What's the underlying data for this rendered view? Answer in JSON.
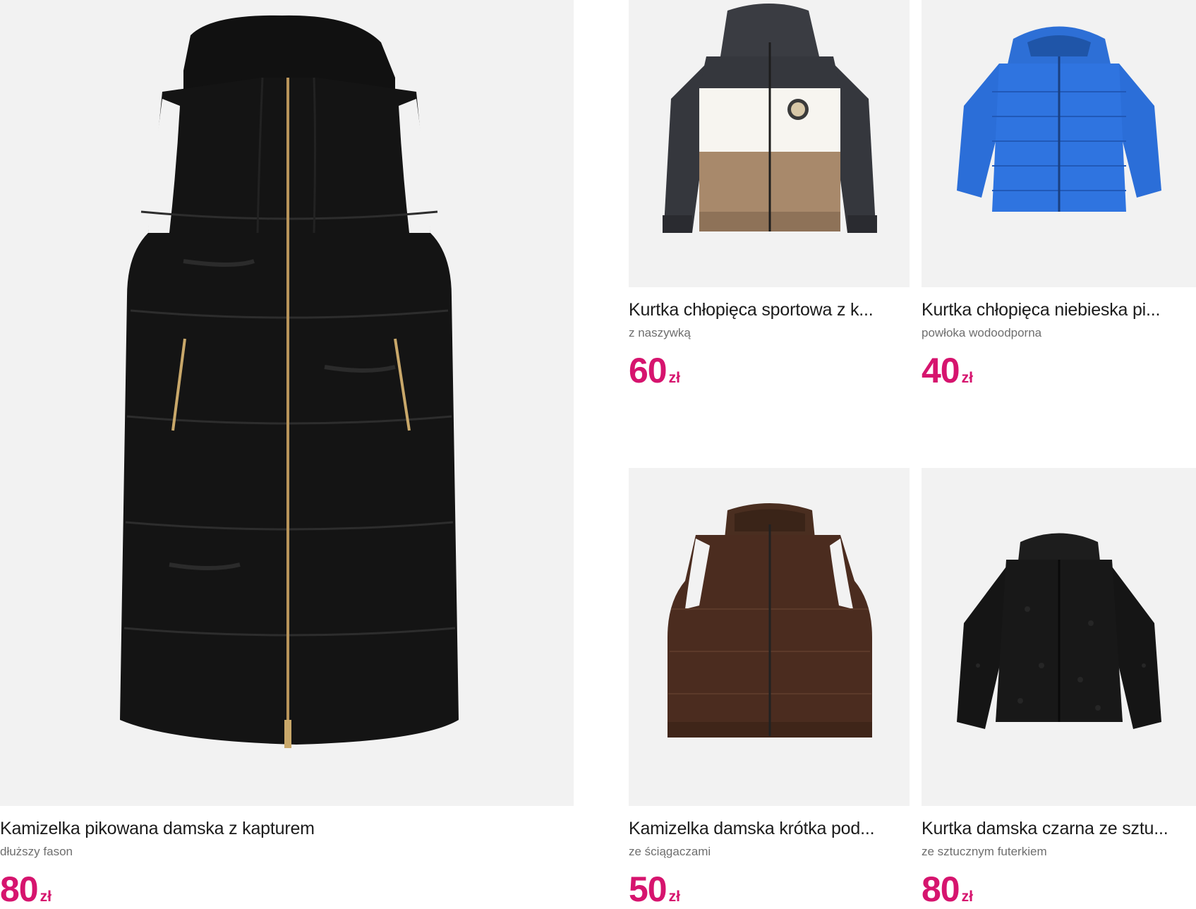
{
  "products": [
    {
      "title": "Kamizelka pikowana damska z kapturem",
      "subtitle": "dłuższy fason",
      "price": "80",
      "currency": "zł",
      "image": "black-long-puffer-vest"
    },
    {
      "title": "Kurtka chłopięca sportowa z k...",
      "subtitle": "z naszywką",
      "price": "60",
      "currency": "zł",
      "image": "colorblock-sport-jacket"
    },
    {
      "title": "Kurtka chłopięca niebieska pi...",
      "subtitle": "powłoka wodoodporna",
      "price": "40",
      "currency": "zł",
      "image": "blue-puffer-jacket"
    },
    {
      "title": "Kamizelka damska krótka pod...",
      "subtitle": "ze ściągaczami",
      "price": "50",
      "currency": "zł",
      "image": "brown-short-vest"
    },
    {
      "title": "Kurtka damska czarna ze sztu...",
      "subtitle": "ze sztucznym futerkiem",
      "price": "80",
      "currency": "zł",
      "image": "black-faux-fur-jacket"
    }
  ],
  "colors": {
    "price": "#d6146e",
    "image_bg": "#f2f2f2"
  }
}
